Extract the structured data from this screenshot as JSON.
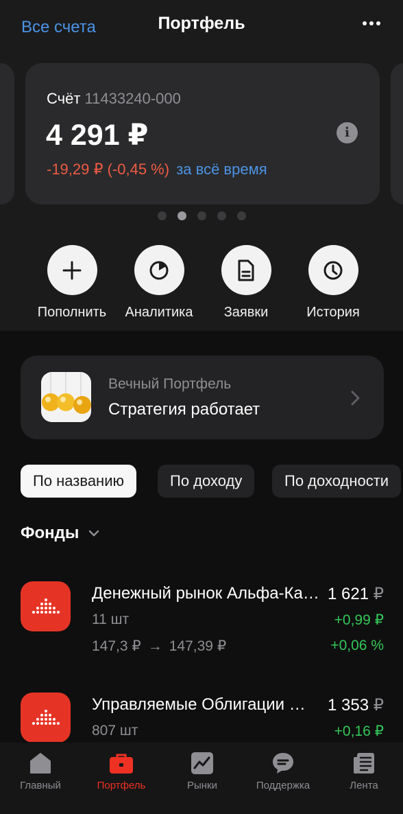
{
  "header": {
    "all_accounts": "Все счета",
    "title": "Портфель",
    "more_icon": "more-horizontal-icon"
  },
  "account": {
    "label": "Счёт",
    "number": "11433240-000",
    "balance": "4 291 ₽",
    "change": "-19,29 ₽ (-0,45 %)",
    "period": "за всё время",
    "info_icon": "info-icon"
  },
  "pager": {
    "count": 5,
    "active_index": 1
  },
  "actions": [
    {
      "label": "Пополнить",
      "icon": "plus-icon"
    },
    {
      "label": "Аналитика",
      "icon": "pie-chart-icon"
    },
    {
      "label": "Заявки",
      "icon": "document-icon"
    },
    {
      "label": "История",
      "icon": "clock-icon"
    }
  ],
  "strategy": {
    "subtitle": "Вечный Портфель",
    "title": "Стратегия работает",
    "image": "newtons-cradle-image"
  },
  "sort_chips": [
    {
      "label": "По названию",
      "active": true
    },
    {
      "label": "По доходу",
      "active": false
    },
    {
      "label": "По доходности",
      "active": false
    }
  ],
  "section": {
    "title": "Фонды"
  },
  "funds": [
    {
      "name": "Денежный рынок Альфа-Капитал",
      "value": "1 621",
      "currency": "₽",
      "qty": "11 шт",
      "price_from": "147,3 ₽",
      "price_to": "147,39 ₽",
      "profit": "+0,99 ₽",
      "yield": "+0,06 %"
    },
    {
      "name": "Управляемые Облигации Альфа-Капитал",
      "value": "1 353",
      "currency": "₽",
      "qty": "807 шт",
      "profit": "+0,16 ₽"
    }
  ],
  "tabbar": [
    {
      "label": "Главный",
      "icon": "home-icon",
      "active": false
    },
    {
      "label": "Портфель",
      "icon": "briefcase-icon",
      "active": true
    },
    {
      "label": "Рынки",
      "icon": "chart-icon",
      "active": false
    },
    {
      "label": "Поддержка",
      "icon": "chat-bubble-icon",
      "active": false
    },
    {
      "label": "Лента",
      "icon": "news-feed-icon",
      "active": false
    }
  ],
  "colors": {
    "accent_blue": "#4b93e5",
    "negative": "#ef5b44",
    "positive": "#34c759",
    "brand_red": "#ef3124"
  }
}
